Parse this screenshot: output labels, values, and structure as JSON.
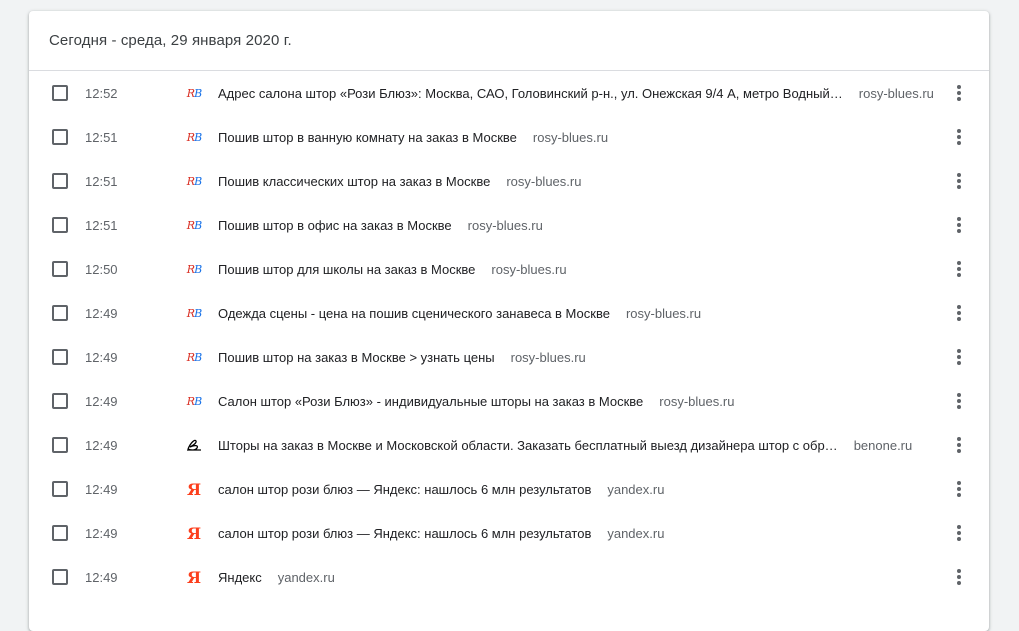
{
  "header": {
    "title": "Сегодня - среда, 29 января 2020 г."
  },
  "colors": {
    "rosy_r": "#d93025",
    "rosy_b": "#1a73e8",
    "yandex": "#fc3f1d"
  },
  "rows": [
    {
      "time": "12:52",
      "icon": "rosy-blues-favicon",
      "title": "Адрес салона штор «Рози Блюз»: Москва, САО, Головинский р-н., ул. Онежская 9/4 А, метро Водный…",
      "domain": "rosy-blues.ru"
    },
    {
      "time": "12:51",
      "icon": "rosy-blues-favicon",
      "title": "Пошив штор в ванную комнату на заказ в Москве",
      "domain": "rosy-blues.ru"
    },
    {
      "time": "12:51",
      "icon": "rosy-blues-favicon",
      "title": "Пошив классических штор на заказ в Москве",
      "domain": "rosy-blues.ru"
    },
    {
      "time": "12:51",
      "icon": "rosy-blues-favicon",
      "title": "Пошив штор в офис на заказ в Москве",
      "domain": "rosy-blues.ru"
    },
    {
      "time": "12:50",
      "icon": "rosy-blues-favicon",
      "title": "Пошив штор для школы на заказ в Москве",
      "domain": "rosy-blues.ru"
    },
    {
      "time": "12:49",
      "icon": "rosy-blues-favicon",
      "title": "Одежда сцены - цена на пошив сценического занавеса в Москве",
      "domain": "rosy-blues.ru"
    },
    {
      "time": "12:49",
      "icon": "rosy-blues-favicon",
      "title": "Пошив штор на заказ в Москве > узнать цены",
      "domain": "rosy-blues.ru"
    },
    {
      "time": "12:49",
      "icon": "rosy-blues-favicon",
      "title": "Салон штор «Рози Блюз» - индивидуальные шторы на заказ в Москве",
      "domain": "rosy-blues.ru"
    },
    {
      "time": "12:49",
      "icon": "benone-favicon",
      "title": "Шторы на заказ в Москве и Московской области. Заказать бесплатный выезд дизайнера штор с обр…",
      "domain": "benone.ru"
    },
    {
      "time": "12:49",
      "icon": "yandex-favicon",
      "title": "салон штор рози блюз — Яндекс: нашлось 6 млн результатов",
      "domain": "yandex.ru"
    },
    {
      "time": "12:49",
      "icon": "yandex-favicon",
      "title": "салон штор рози блюз — Яндекс: нашлось 6 млн результатов",
      "domain": "yandex.ru"
    },
    {
      "time": "12:49",
      "icon": "yandex-favicon",
      "title": "Яндекс",
      "domain": "yandex.ru"
    }
  ],
  "icon_glyphs": {
    "rosy_r": "R",
    "rosy_b": "B",
    "benone": "ℬ",
    "yandex": "Я"
  }
}
